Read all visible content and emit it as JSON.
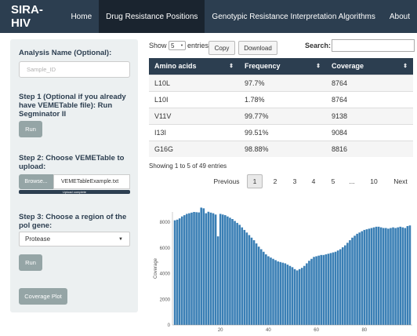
{
  "navbar": {
    "brand": "SIRA-HIV",
    "items": [
      "Home",
      "Drug Resistance Positions",
      "Genotypic Resistance Interpretation Algorithms",
      "About"
    ]
  },
  "sidebar": {
    "analysis_label": "Analysis Name (Optional):",
    "analysis_placeholder": "Sample_ID",
    "step1_label": "Step 1 (Optional if you already have VEMETable file): Run Segminator II",
    "step1_button": "Run",
    "step2_label": "Step 2: Choose VEMETable to upload:",
    "browse_label": "Browse...",
    "file_name": "VEMETableExample.txt",
    "upload_status": "Upload complete",
    "upload_progress": 1.0,
    "step3_label": "Step 3: Choose a region of the pol gene:",
    "region_value": "Protease",
    "run_button": "Run",
    "coverage_button": "Coverage Plot"
  },
  "table_controls": {
    "show_label": "Show",
    "entries_value": "5",
    "entries_label": "entries",
    "copy_button": "Copy",
    "download_button": "Download",
    "search_label": "Search:"
  },
  "table": {
    "columns": [
      "Amino acids",
      "Frequency",
      "Coverage"
    ],
    "rows": [
      [
        "L10L",
        "97.7%",
        "8764"
      ],
      [
        "L10I",
        "1.78%",
        "8764"
      ],
      [
        "V11V",
        "99.77%",
        "9138"
      ],
      [
        "I13I",
        "99.51%",
        "9084"
      ],
      [
        "G16G",
        "98.88%",
        "8816"
      ]
    ],
    "info": "Showing 1 to 5 of 49 entries"
  },
  "pagination": {
    "previous": "Previous",
    "pages": [
      "1",
      "2",
      "3",
      "4",
      "5",
      "...",
      "10"
    ],
    "current": "1",
    "next": "Next"
  },
  "chart_data": {
    "type": "bar",
    "ylabel": "Coverage",
    "xlabel": "",
    "xlim": [
      0,
      100
    ],
    "ylim": [
      0,
      8800
    ],
    "x_ticks": [
      "20",
      "40",
      "60",
      "80"
    ],
    "y_ticks": [
      "0",
      "2000",
      "4000",
      "6000",
      "8000"
    ],
    "color": "#3a7fb5",
    "x": [
      1,
      2,
      3,
      4,
      5,
      6,
      7,
      8,
      9,
      10,
      11,
      12,
      13,
      14,
      15,
      16,
      17,
      18,
      19,
      20,
      21,
      22,
      23,
      24,
      25,
      26,
      27,
      28,
      29,
      30,
      31,
      32,
      33,
      34,
      35,
      36,
      37,
      38,
      39,
      40,
      41,
      42,
      43,
      44,
      45,
      46,
      47,
      48,
      49,
      50,
      51,
      52,
      53,
      54,
      55,
      56,
      57,
      58,
      59,
      60,
      61,
      62,
      63,
      64,
      65,
      66,
      67,
      68,
      69,
      70,
      71,
      72,
      73,
      74,
      75,
      76,
      77,
      78,
      79,
      80,
      81,
      82,
      83,
      84,
      85,
      86,
      87,
      88,
      89,
      90,
      91,
      92,
      93,
      94,
      95,
      96,
      97,
      98,
      99
    ],
    "values": [
      8150,
      8200,
      8300,
      8450,
      8550,
      8650,
      8700,
      8750,
      8800,
      8780,
      8764,
      9138,
      9084,
      8700,
      8816,
      8750,
      8700,
      8600,
      6900,
      8650,
      8600,
      8550,
      8450,
      8350,
      8250,
      8100,
      7950,
      7800,
      7600,
      7400,
      7200,
      7000,
      6800,
      6600,
      6350,
      6100,
      5900,
      5700,
      5500,
      5350,
      5250,
      5150,
      5050,
      4950,
      4900,
      4850,
      4800,
      4700,
      4600,
      4500,
      4350,
      4250,
      4350,
      4450,
      4600,
      4800,
      5000,
      5150,
      5300,
      5350,
      5400,
      5450,
      5450,
      5500,
      5550,
      5600,
      5650,
      5700,
      5800,
      5900,
      6050,
      6200,
      6400,
      6600,
      6800,
      6950,
      7100,
      7200,
      7300,
      7400,
      7450,
      7500,
      7550,
      7600,
      7650,
      7650,
      7600,
      7550,
      7550,
      7500,
      7550,
      7600,
      7550,
      7600,
      7650,
      7600,
      7550,
      7700,
      7750
    ]
  }
}
